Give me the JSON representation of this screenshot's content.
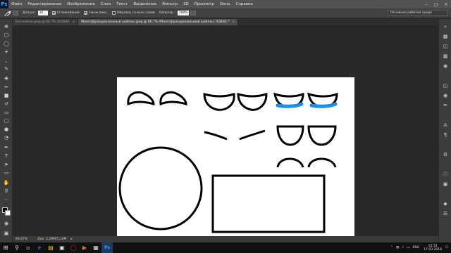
{
  "app": {
    "logo": "Ps"
  },
  "menu": [
    "Файл",
    "Редактирование",
    "Изображение",
    "Слои",
    "Текст",
    "Выделение",
    "Фильтр",
    "3D",
    "Просмотр",
    "Окно",
    "Справка"
  ],
  "options_bar": {
    "tool_icon": "eyedropper-icon",
    "tolerance_label": "Допуск:",
    "tolerance_value": "32",
    "smoothing_label": "Сглаживание",
    "contiguous_label": "Смеж.пикс.",
    "all_layers_label": "Образец со всех слоев",
    "opacity_label": "Непрозр.:",
    "opacity_value": "100%",
    "workspace": "Основная рабочая среда"
  },
  "tabs": [
    {
      "label": "Без имени.jpeg @ 66,7% (RGB/8)",
      "active": false
    },
    {
      "label": "Многофункциональный шаблон.jpeg @ 66,7% (Многофункциональный шаблон, RGB/8) *",
      "active": true
    }
  ],
  "status": {
    "zoom": "66,67%",
    "doc": "Док: 2,29M/5,14M"
  },
  "taskbar": {
    "lang": "ENG",
    "time": "12:33",
    "date": "17.03.2018"
  },
  "colors": {
    "accent_blue": "#1e90e8",
    "stroke": "#000000"
  }
}
